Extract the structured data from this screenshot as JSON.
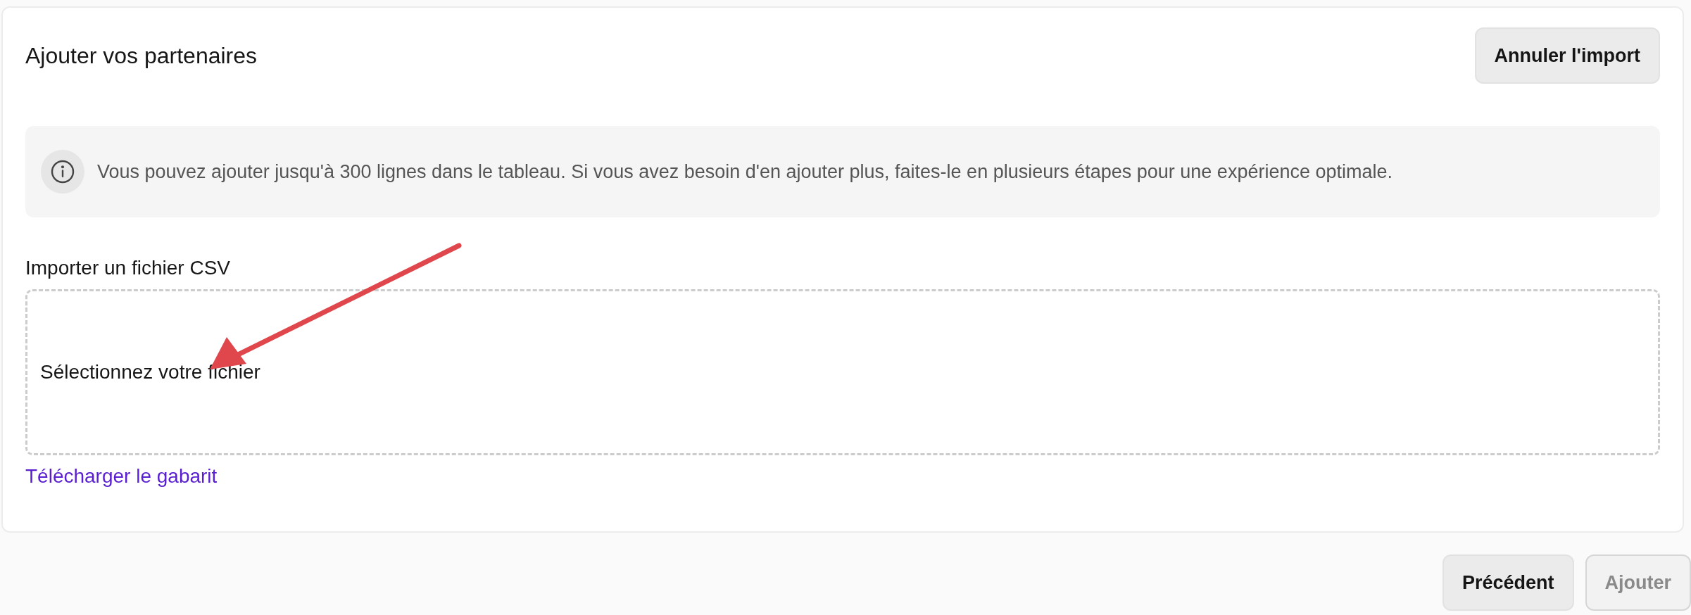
{
  "title": "Ajouter vos partenaires",
  "cancel_button": {
    "label": "Annuler l'import"
  },
  "info": {
    "text": "Vous pouvez ajouter jusqu'à 300 lignes dans le tableau. Si vous avez besoin d'en ajouter plus, faites-le en plusieurs étapes pour une expérience optimale."
  },
  "import": {
    "label": "Importer un fichier CSV",
    "dropzone_text": "Sélectionnez votre fichier",
    "template_link": "Télécharger le gabarit"
  },
  "footer_buttons": [
    {
      "label": "Précédent",
      "disabled": false
    },
    {
      "label": "Ajouter",
      "disabled": true
    }
  ]
}
